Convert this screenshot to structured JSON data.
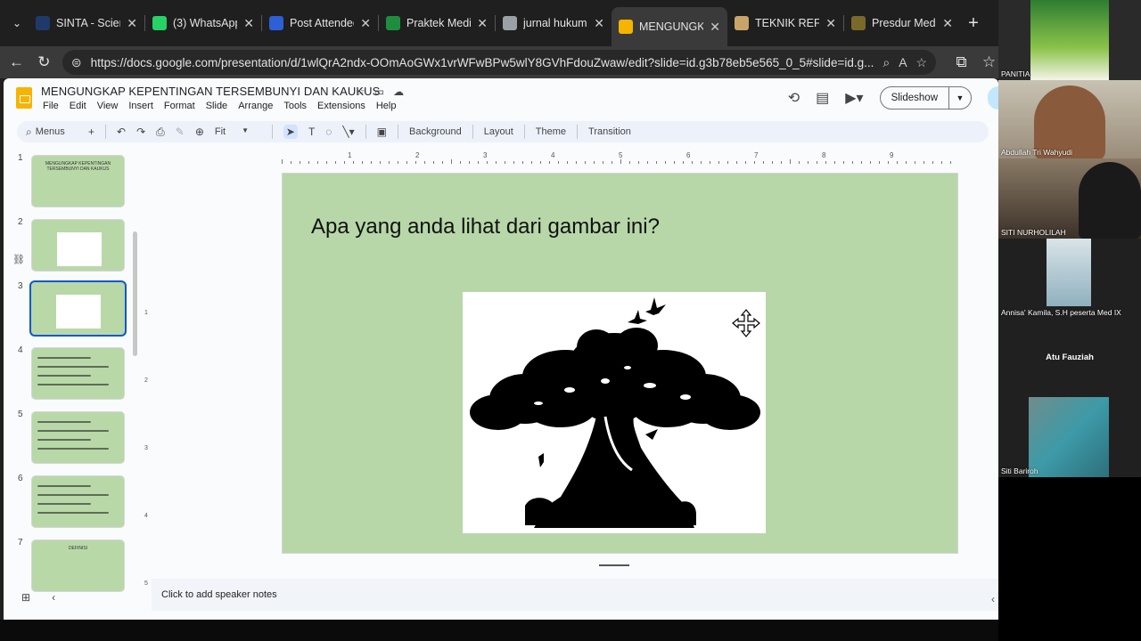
{
  "browser": {
    "tabs": [
      {
        "title": "SINTA - Science",
        "icon": "sinta-favicon",
        "color": "#1e3a6b",
        "active": false
      },
      {
        "title": "(3) WhatsApp",
        "icon": "whatsapp-icon",
        "color": "#25d366",
        "active": false
      },
      {
        "title": "Post Attendee",
        "icon": "zoom-icon",
        "color": "#2d5fd6",
        "active": false
      },
      {
        "title": "Praktek Media",
        "icon": "drive-icon",
        "color": "#1e8e3e",
        "active": false
      },
      {
        "title": "jurnal hukum",
        "icon": "google-icon",
        "color": "#9aa0a6",
        "active": false
      },
      {
        "title": "MENGUNGKAP",
        "icon": "slides-icon",
        "color": "#f6b400",
        "active": true
      },
      {
        "title": "TEKNIK REFRA",
        "icon": "slides-icon",
        "color": "#c9a46a",
        "active": false
      },
      {
        "title": "Presdur Media",
        "icon": "site-icon",
        "color": "#7a6a2a",
        "active": false
      }
    ],
    "url": "https://docs.google.com/presentation/d/1wlQrA2ndx-OOmAoGWx1vrWFwBPw5wlY8GVhFdouZwaw/edit?slide=id.g3b78eb5e565_0_5#slide=id.g..."
  },
  "app": {
    "doc_title": "MENGUNGKAP KEPENTINGAN TERSEMBUNYI DAN KAUKUS",
    "menu": [
      "File",
      "Edit",
      "View",
      "Insert",
      "Format",
      "Slide",
      "Arrange",
      "Tools",
      "Extensions",
      "Help"
    ],
    "slideshow_label": "Slideshow",
    "toolbar": {
      "menus_label": "Menus",
      "zoom_label": "Fit",
      "background": "Background",
      "layout": "Layout",
      "theme": "Theme",
      "transition": "Transition"
    },
    "ruler_top": [
      "1",
      "2",
      "3",
      "4",
      "5",
      "6",
      "7",
      "8",
      "9"
    ],
    "ruler_left": [
      "1",
      "2",
      "3",
      "4",
      "5"
    ],
    "slides": [
      {
        "num": "1",
        "title": "MENGUNGKAP KEPENTINGAN TERSEMBUNYI DAN KAUKUS"
      },
      {
        "num": "2",
        "title": ""
      },
      {
        "num": "3",
        "title": ""
      },
      {
        "num": "4",
        "title": ""
      },
      {
        "num": "5",
        "title": ""
      },
      {
        "num": "6",
        "title": ""
      },
      {
        "num": "7",
        "title": "DEFINISI"
      }
    ],
    "current_slide": {
      "title": "Apa yang anda lihat dari gambar ini?",
      "image": "tree-silhouette-with-faces-and-birds"
    },
    "speaker_notes_placeholder": "Click to add speaker notes",
    "colors": {
      "slide_bg": "#b7d7a8",
      "accent": "#0b57d0"
    }
  },
  "meeting": {
    "participants": [
      {
        "name": "PANITIA",
        "image": "webinar-poster"
      },
      {
        "name": "Abdullah Tri Wahyudi",
        "image": "man-with-glasses-video"
      },
      {
        "name": "SITI NURHOLILAH",
        "image": "woman-in-hijab-video"
      },
      {
        "name": "Annisa' Kamila, S.H peserta Med IX",
        "image": "woman-with-glasses-video"
      },
      {
        "name": "Atu Fauziah",
        "image": ""
      },
      {
        "name": "Siti Bariroh",
        "image": "woman-reading-book-video"
      }
    ]
  }
}
